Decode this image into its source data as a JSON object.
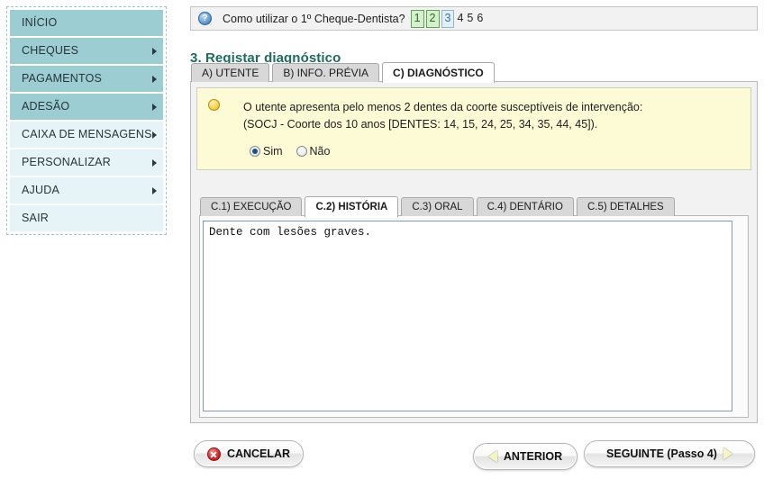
{
  "sidebar": {
    "items": [
      {
        "label": "INÍCIO",
        "style": "teal",
        "arrow": false
      },
      {
        "label": "CHEQUES",
        "style": "teal",
        "arrow": true
      },
      {
        "label": "PAGAMENTOS",
        "style": "teal",
        "arrow": true
      },
      {
        "label": "ADESÃO",
        "style": "teal",
        "arrow": true
      },
      {
        "label": "CAIXA DE MENSAGENS",
        "style": "pale",
        "arrow": true
      },
      {
        "label": "PERSONALIZAR",
        "style": "pale",
        "arrow": true
      },
      {
        "label": "AJUDA",
        "style": "pale",
        "arrow": true
      },
      {
        "label": "SAIR",
        "style": "pale",
        "arrow": false
      }
    ]
  },
  "helpbar": {
    "icon": "help-question-icon",
    "text": "Como utilizar o 1º Cheque-Dentista?",
    "steps": [
      {
        "label": "1",
        "state": "done"
      },
      {
        "label": "2",
        "state": "done"
      },
      {
        "label": "3",
        "state": "current"
      },
      {
        "label": "4",
        "state": "todo"
      },
      {
        "label": "5",
        "state": "todo"
      },
      {
        "label": "6",
        "state": "todo"
      }
    ]
  },
  "page": {
    "title": "3. Registar diagnóstico",
    "title_color": "#1f6b5e"
  },
  "main_tabs": [
    {
      "label": "A) UTENTE",
      "active": false
    },
    {
      "label": "B) INFO. PRÉVIA",
      "active": false
    },
    {
      "label": "C) DIAGNÓSTICO",
      "active": true
    }
  ],
  "condition": {
    "bullet_icon": "amber-bullet-icon",
    "line1": "O utente apresenta pelo menos 2 dentes da coorte susceptíveis de intervenção:",
    "line2": "(SOCJ - Coorte dos 10 anos [DENTES: 14, 15, 24, 25, 34, 35, 44, 45]).",
    "options": [
      {
        "label": "Sim",
        "checked": true
      },
      {
        "label": "Não",
        "checked": false
      }
    ]
  },
  "sub_tabs": [
    {
      "label": "C.1) EXECUÇÃO",
      "active": false
    },
    {
      "label": "C.2) HISTÓRIA",
      "active": true
    },
    {
      "label": "C.3) ORAL",
      "active": false
    },
    {
      "label": "C.4) DENTÁRIO",
      "active": false
    },
    {
      "label": "C.5) DETALHES",
      "active": false
    }
  ],
  "history": {
    "value": "Dente com lesões graves.",
    "placeholder": ""
  },
  "buttons": {
    "cancelar": {
      "label": "CANCELAR",
      "icon": "cancel-x-icon"
    },
    "anterior": {
      "label": "ANTERIOR",
      "icon": "triangle-left-icon"
    },
    "seguinte": {
      "label": "SEGUINTE (Passo 4)",
      "icon": "triangle-right-icon"
    }
  }
}
